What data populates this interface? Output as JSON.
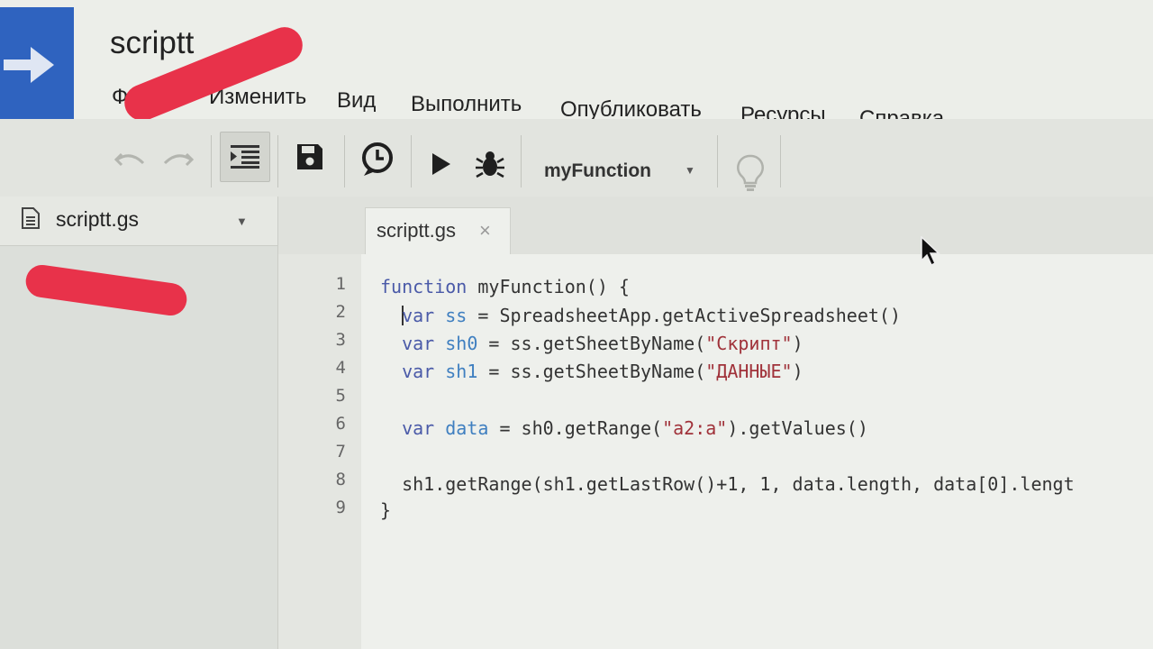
{
  "app": {
    "title": "scriptt"
  },
  "menu": [
    "Файл",
    "Изменить",
    "Вид",
    "Выполнить",
    "Опубликовать",
    "Ресурсы",
    "Справка"
  ],
  "toolbar": {
    "icons": [
      "undo-icon",
      "redo-icon",
      "indent-icon",
      "save-icon",
      "triggers-clock-icon",
      "run-icon",
      "debug-bug-icon",
      "lightbulb-icon"
    ],
    "function_select": "myFunction"
  },
  "sidebar": {
    "file": "scriptt.gs"
  },
  "editor": {
    "tab": {
      "label": "scriptt.gs",
      "close": "×"
    },
    "line_numbers": [
      "1",
      "2",
      "3",
      "4",
      "5",
      "6",
      "7",
      "8",
      "9"
    ],
    "lines": [
      "function myFunction() {",
      "  var ss = SpreadsheetApp.getActiveSpreadsheet()",
      "  var sh0 = ss.getSheetByName(\"Скрипт\")",
      "  var sh1 = ss.getSheetByName(\"ДАННЫЕ\")",
      "",
      "  var data = sh0.getRange(\"a2:a\").getValues()",
      "",
      "  sh1.getRange(sh1.getLastRow()+1, 1, data.length, data[0].lengt",
      "}"
    ]
  },
  "colors": {
    "keyword": "#4a5aa8",
    "variable": "#3f7fc0",
    "string": "#a0323a",
    "logo": "#2f63bf",
    "redaction": "#e8324a"
  }
}
